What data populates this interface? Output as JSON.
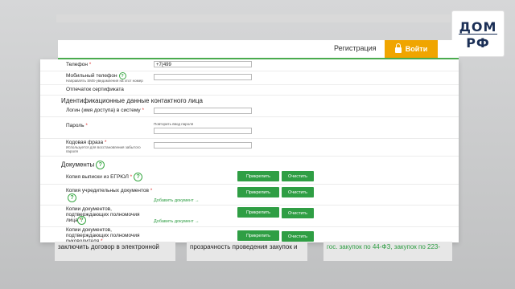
{
  "header": {
    "register_label": "Регистрация",
    "login_label": "Войти",
    "logo": {
      "line1": "ДОМ",
      "line2": "РФ"
    }
  },
  "form": {
    "phone": {
      "label": "Телефон",
      "required": "*",
      "value": "+7(499"
    },
    "mobile": {
      "label": "Мобильный телефон",
      "hint": "Направлять SMS-уведомления на этот номер",
      "value": ""
    },
    "cert_print": {
      "label": "Отпечаток сертификата"
    },
    "contact_section": "Идентификационные данные контактного лица",
    "login": {
      "label": "Логин (имя доступа) в систему",
      "required": "*",
      "value": ""
    },
    "password": {
      "label": "Пароль",
      "required": "*",
      "repeat_hint": "Повторить ввод пароля"
    },
    "code_phrase": {
      "label": "Кодовая фраза",
      "required": "*",
      "hint": "Используется для восстановления забытого пароля"
    },
    "documents_section": "Документы",
    "docs": [
      {
        "label": "Копия выписки из ЕГРЮЛ",
        "required": "*",
        "attach": "Прикрепить",
        "clear": "Очистить"
      },
      {
        "label": "Копия учредительных документов",
        "required": "*",
        "attach": "Прикрепить",
        "clear": "Очистить",
        "add": "Добавить документ →"
      },
      {
        "label": "Копии документов, подтверждающих полномочия лица",
        "required": "*",
        "attach": "Прикрепить",
        "clear": "Очистить",
        "add": "Добавить документ →"
      },
      {
        "label": "Копии документов, подтверждающих полномочия руководителя",
        "required": "*",
        "attach": "Прикрепить",
        "clear": "Очистить"
      }
    ]
  },
  "bottom": {
    "col1": "заключить договор в электронной",
    "col2": "прозрачность проведения закупок и",
    "col3": "гос. закупок по 44-ФЗ, закупок по 223-"
  },
  "colors": {
    "accent_green": "#2f9e44",
    "login_orange": "#f0a500",
    "logo_blue": "#1b2f56"
  }
}
